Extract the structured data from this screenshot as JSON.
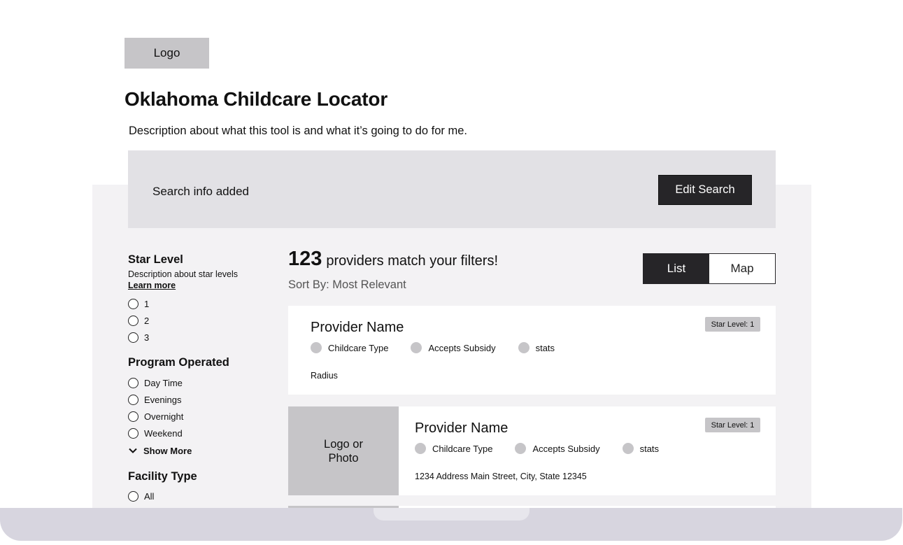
{
  "header": {
    "logo_label": "Logo",
    "title": "Oklahoma Childcare Locator",
    "description": "Description about what this tool is and what it’s going to do for me."
  },
  "search": {
    "info": "Search info added",
    "edit_label": "Edit Search"
  },
  "filters": {
    "star_level": {
      "title": "Star Level",
      "description": "Description about star levels",
      "link": "Learn more",
      "options": [
        "1",
        "2",
        "3"
      ]
    },
    "program_operated": {
      "title": "Program Operated",
      "options": [
        "Day Time",
        "Evenings",
        "Overnight",
        "Weekend"
      ],
      "show_more": "Show More"
    },
    "facility_type": {
      "title": "Facility Type",
      "options": [
        "All"
      ]
    }
  },
  "results": {
    "count": "123",
    "count_text": "providers match your filters!",
    "sort": "Sort By: Most Relevant",
    "view_toggle": {
      "list": "List",
      "map": "Map",
      "active": "list"
    },
    "cards": [
      {
        "name": "Provider Name",
        "star_badge": "Star Level: 1",
        "tags": [
          "Childcare Type",
          "Accepts Subsidy",
          "stats"
        ],
        "meta": "Radius"
      },
      {
        "photo_label": "Logo or\nPhoto",
        "name": "Provider Name",
        "star_badge": "Star Level: 1",
        "tags": [
          "Childcare Type",
          "Accepts Subsidy",
          "stats"
        ],
        "meta": "1234 Address Main Street, City, State 12345"
      }
    ]
  },
  "colors": {
    "dark": "#262528",
    "gray_box": "#c6c5c8",
    "panel_bg": "#f3f2f4",
    "search_bg": "#e2e1e5",
    "laptop_base": "#d7d5df"
  }
}
